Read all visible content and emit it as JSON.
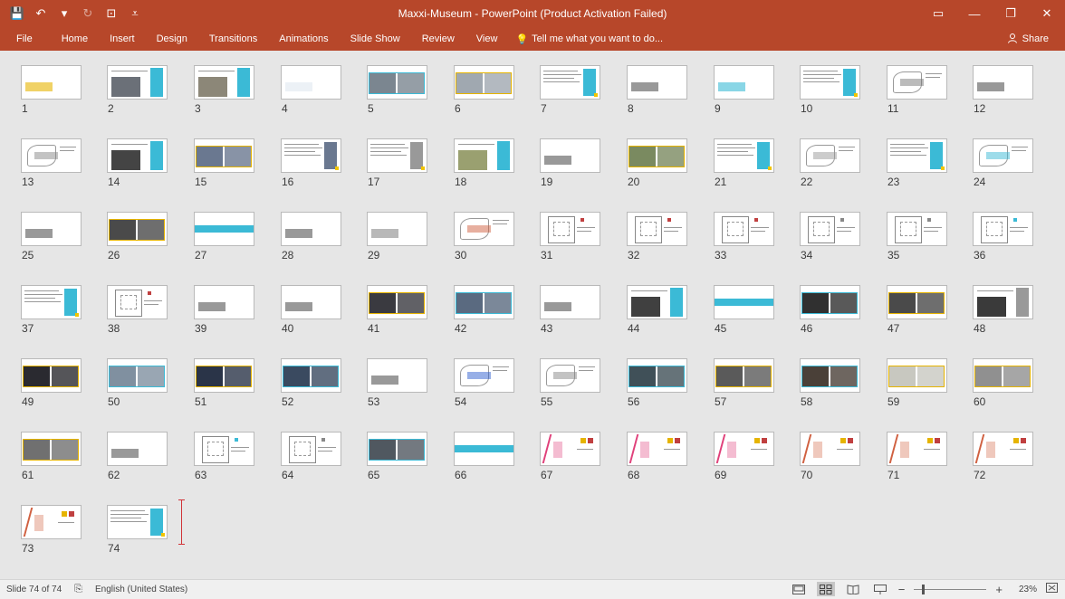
{
  "titlebar": {
    "title": "Maxxi-Museum - PowerPoint (Product Activation Failed)",
    "qat": [
      {
        "name": "save-icon",
        "glyph": "💾"
      },
      {
        "name": "undo-icon",
        "glyph": "↶"
      },
      {
        "name": "undo-dropdown-icon",
        "glyph": "▾"
      },
      {
        "name": "redo-icon",
        "glyph": "↻"
      },
      {
        "name": "start-from-beginning-icon",
        "glyph": "⊡"
      },
      {
        "name": "customize-qat-icon",
        "glyph": "⩡"
      }
    ],
    "window_buttons": [
      {
        "name": "ribbon-display-options-icon",
        "glyph": "▭"
      },
      {
        "name": "minimize-icon",
        "glyph": "—"
      },
      {
        "name": "maximize-icon",
        "glyph": "❐"
      },
      {
        "name": "close-icon",
        "glyph": "✕"
      }
    ]
  },
  "ribbon": {
    "tabs": [
      "File",
      "Home",
      "Insert",
      "Design",
      "Transitions",
      "Animations",
      "Slide Show",
      "Review",
      "View"
    ],
    "tell_me": "Tell me what you want to do...",
    "share": "Share"
  },
  "slides": [
    {
      "n": "1",
      "k": "photo",
      "c": "#8a8f96",
      "acc": "#e6b400"
    },
    {
      "n": "2",
      "k": "split",
      "c": "#6b7078",
      "acc": "#3bbad6"
    },
    {
      "n": "3",
      "k": "split",
      "c": "#8c8778",
      "acc": "#3bbad6"
    },
    {
      "n": "4",
      "k": "photo",
      "c": "#1a2a4a",
      "acc": "#e0e8f0"
    },
    {
      "n": "5",
      "k": "duo",
      "c": "#7b8690",
      "acc": "#3bbad6"
    },
    {
      "n": "6",
      "k": "duo",
      "c": "#a0a8b0",
      "acc": "#e6b400"
    },
    {
      "n": "7",
      "k": "text",
      "c": "#ffffff",
      "acc": "#3bbad6"
    },
    {
      "n": "8",
      "k": "photo",
      "c": "#9a9a98",
      "acc": "#555"
    },
    {
      "n": "9",
      "k": "photo",
      "c": "#5a4a30",
      "acc": "#3bbad6"
    },
    {
      "n": "10",
      "k": "text",
      "c": "#ffffff",
      "acc": "#3bbad6"
    },
    {
      "n": "11",
      "k": "sketch",
      "c": "#ffffff",
      "acc": "#777"
    },
    {
      "n": "12",
      "k": "photo",
      "c": "#7a6050",
      "acc": "#555"
    },
    {
      "n": "13",
      "k": "sketch",
      "c": "#ffffff",
      "acc": "#888"
    },
    {
      "n": "14",
      "k": "split",
      "c": "#444",
      "acc": "#3bbad6"
    },
    {
      "n": "15",
      "k": "duo",
      "c": "#6a7890",
      "acc": "#e6b400"
    },
    {
      "n": "16",
      "k": "text",
      "c": "#ffffff",
      "acc": "#6a7890"
    },
    {
      "n": "17",
      "k": "text",
      "c": "#ffffff",
      "acc": "#999"
    },
    {
      "n": "18",
      "k": "split",
      "c": "#9aa070",
      "acc": "#3bbad6"
    },
    {
      "n": "19",
      "k": "photo",
      "c": "#8a7858",
      "acc": "#555"
    },
    {
      "n": "20",
      "k": "duo",
      "c": "#7a8a60",
      "acc": "#e6b400"
    },
    {
      "n": "21",
      "k": "text",
      "c": "#ffffff",
      "acc": "#3bbad6"
    },
    {
      "n": "22",
      "k": "sketch",
      "c": "#ffffff",
      "acc": "#999"
    },
    {
      "n": "23",
      "k": "text",
      "c": "#ffffff",
      "acc": "#3bbad6"
    },
    {
      "n": "24",
      "k": "sketch",
      "c": "#ffffff",
      "acc": "#3bbad6"
    },
    {
      "n": "25",
      "k": "photo",
      "c": "#9a7a50",
      "acc": "#555"
    },
    {
      "n": "26",
      "k": "duo",
      "c": "#4a4a4a",
      "acc": "#e6b400"
    },
    {
      "n": "27",
      "k": "band",
      "c": "#ffffff",
      "acc": "#3bbad6"
    },
    {
      "n": "28",
      "k": "photo",
      "c": "#a8a8a0",
      "acc": "#555"
    },
    {
      "n": "29",
      "k": "photo",
      "c": "#404850",
      "acc": "#888"
    },
    {
      "n": "30",
      "k": "sketch",
      "c": "#ffffff",
      "acc": "#d06040"
    },
    {
      "n": "31",
      "k": "plan",
      "c": "#ffffff",
      "acc": "#c04040"
    },
    {
      "n": "32",
      "k": "plan",
      "c": "#ffffff",
      "acc": "#c04040"
    },
    {
      "n": "33",
      "k": "plan",
      "c": "#ffffff",
      "acc": "#c04040"
    },
    {
      "n": "34",
      "k": "plan",
      "c": "#ffffff",
      "acc": "#888"
    },
    {
      "n": "35",
      "k": "plan",
      "c": "#ffffff",
      "acc": "#888"
    },
    {
      "n": "36",
      "k": "plan",
      "c": "#ffffff",
      "acc": "#3bbad6"
    },
    {
      "n": "37",
      "k": "text",
      "c": "#ffffff",
      "acc": "#3bbad6"
    },
    {
      "n": "38",
      "k": "plan",
      "c": "#ffffff",
      "acc": "#c04040"
    },
    {
      "n": "39",
      "k": "photo",
      "c": "#808890",
      "acc": "#555"
    },
    {
      "n": "40",
      "k": "photo",
      "c": "#6a7880",
      "acc": "#555"
    },
    {
      "n": "41",
      "k": "duo",
      "c": "#3a3a40",
      "acc": "#e6b400"
    },
    {
      "n": "42",
      "k": "duo",
      "c": "#5a6a80",
      "acc": "#3bbad6"
    },
    {
      "n": "43",
      "k": "photo",
      "c": "#b8c0c8",
      "acc": "#555"
    },
    {
      "n": "44",
      "k": "split",
      "c": "#404040",
      "acc": "#3bbad6"
    },
    {
      "n": "45",
      "k": "band",
      "c": "#ffffff",
      "acc": "#3bbad6"
    },
    {
      "n": "46",
      "k": "duo",
      "c": "#303030",
      "acc": "#3bbad6"
    },
    {
      "n": "47",
      "k": "duo",
      "c": "#4a4a4a",
      "acc": "#e6b400"
    },
    {
      "n": "48",
      "k": "split",
      "c": "#3a3a3a",
      "acc": "#999"
    },
    {
      "n": "49",
      "k": "duo",
      "c": "#2a2a30",
      "acc": "#e6b400"
    },
    {
      "n": "50",
      "k": "duo",
      "c": "#8090a0",
      "acc": "#3bbad6"
    },
    {
      "n": "51",
      "k": "duo",
      "c": "#2a3448",
      "acc": "#e6b400"
    },
    {
      "n": "52",
      "k": "duo",
      "c": "#3a4a60",
      "acc": "#3bbad6"
    },
    {
      "n": "53",
      "k": "photo",
      "c": "#707478",
      "acc": "#555"
    },
    {
      "n": "54",
      "k": "sketch",
      "c": "#ffffff",
      "acc": "#3060d0"
    },
    {
      "n": "55",
      "k": "sketch",
      "c": "#ffffff",
      "acc": "#888"
    },
    {
      "n": "56",
      "k": "duo",
      "c": "#405058",
      "acc": "#3bbad6"
    },
    {
      "n": "57",
      "k": "duo",
      "c": "#5a5a5a",
      "acc": "#e6b400"
    },
    {
      "n": "58",
      "k": "duo",
      "c": "#4a4038",
      "acc": "#3bbad6"
    },
    {
      "n": "59",
      "k": "duo",
      "c": "#c8c8c0",
      "acc": "#e6b400"
    },
    {
      "n": "60",
      "k": "duo",
      "c": "#909090",
      "acc": "#e6b400"
    },
    {
      "n": "61",
      "k": "duo",
      "c": "#707070",
      "acc": "#e6b400"
    },
    {
      "n": "62",
      "k": "photo",
      "c": "#5a5a58",
      "acc": "#555"
    },
    {
      "n": "63",
      "k": "plan",
      "c": "#ffffff",
      "acc": "#3bbad6"
    },
    {
      "n": "64",
      "k": "plan",
      "c": "#ffffff",
      "acc": "#888"
    },
    {
      "n": "65",
      "k": "duo",
      "c": "#505860",
      "acc": "#3bbad6"
    },
    {
      "n": "66",
      "k": "band",
      "c": "#ffffff",
      "acc": "#3bbad6"
    },
    {
      "n": "67",
      "k": "map",
      "c": "#ffffff",
      "acc": "#e0407a"
    },
    {
      "n": "68",
      "k": "map",
      "c": "#ffffff",
      "acc": "#e0407a"
    },
    {
      "n": "69",
      "k": "map",
      "c": "#ffffff",
      "acc": "#e0407a"
    },
    {
      "n": "70",
      "k": "map",
      "c": "#ffffff",
      "acc": "#d06040"
    },
    {
      "n": "71",
      "k": "map",
      "c": "#ffffff",
      "acc": "#d06040"
    },
    {
      "n": "72",
      "k": "map",
      "c": "#ffffff",
      "acc": "#d06040"
    },
    {
      "n": "73",
      "k": "map",
      "c": "#ffffff",
      "acc": "#d06040"
    },
    {
      "n": "74",
      "k": "text",
      "c": "#ffffff",
      "acc": "#3bbad6"
    }
  ],
  "status": {
    "slide_info": "Slide 74 of 74",
    "language": "English (United States)",
    "zoom": "23%",
    "zoom_fraction": 0.23
  }
}
